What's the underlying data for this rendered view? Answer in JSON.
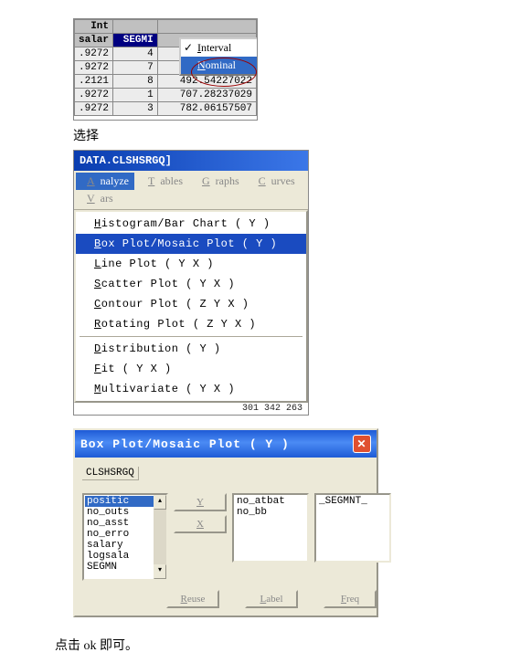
{
  "shot1": {
    "headers": [
      "Int",
      "salar",
      "SEGMI"
    ],
    "rows": [
      [
        "",
        ".9272",
        "4"
      ],
      [
        "",
        ".9272",
        "7"
      ],
      [
        "",
        ".2121",
        "8",
        "492.54227022"
      ],
      [
        "",
        ".9272",
        "1",
        "707.28237029"
      ],
      [
        "",
        ".9272",
        "3",
        "782.06157507"
      ]
    ],
    "menu": {
      "interval": "Interval",
      "nominal": "Nominal"
    }
  },
  "caption1": "选择",
  "shot2": {
    "title": "DATA.CLSHSRGQ]",
    "menus": [
      "Analyze",
      "Tables",
      "Graphs",
      "Curves",
      "Vars"
    ],
    "items": [
      "Histogram/Bar Chart ( Y )",
      "Box Plot/Mosaic Plot ( Y )",
      "Line Plot ( Y X )",
      "Scatter Plot ( Y X )",
      "Contour Plot ( Z Y X )",
      "Rotating Plot ( Z Y X )",
      "Distribution ( Y )",
      "Fit ( Y X )",
      "Multivariate ( Y X )"
    ],
    "bottom": "301    342    263"
  },
  "shot3": {
    "title": "Box Plot/Mosaic Plot ( Y )",
    "label": "CLSHSRGQ",
    "list1": [
      "positic",
      "no_outs",
      "no_asst",
      "no_erro",
      "salary",
      "logsala",
      "SEGMN"
    ],
    "btns_mid": [
      "Y",
      "X"
    ],
    "list2": [
      "no_atbat",
      "no_bb"
    ],
    "list3": [
      "_SEGMNT_"
    ],
    "btns_bottom": [
      "Reuse",
      "Label",
      "Freq"
    ]
  },
  "caption2": "点击 ok 即可。"
}
